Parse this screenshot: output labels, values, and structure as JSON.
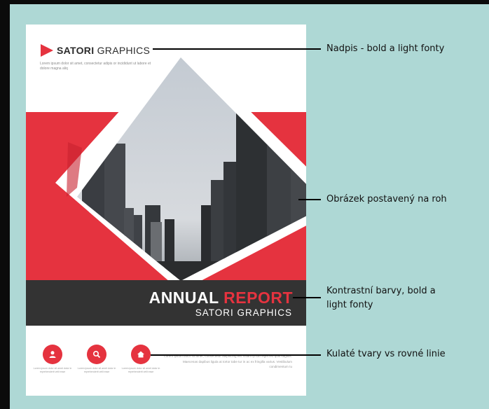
{
  "brochure": {
    "logo": {
      "bold": "SATORI",
      "light": "GRAPHICS"
    },
    "tagline": "Lorem ipsum dolor sit amet, consectetur adipis or incididunt ut labore et dolore magna aliq",
    "report_title": {
      "bold": "ANNUAL",
      "accent": "REPORT"
    },
    "report_subtitle": "SATORI GRAPHICS",
    "icons": [
      {
        "icon": "user-icon",
        "caption": "Lorem ipsum dolor sit amet dolor in reprehenderit velit esse"
      },
      {
        "icon": "search-icon",
        "caption": "Lorem ipsum dolor sit amet dolor in reprehenderit velit esse"
      },
      {
        "icon": "home-icon",
        "caption": "Lorem ipsum dolor sit amet dolor in reprehenderit velit esse"
      }
    ],
    "footer_text": "Lorem ipsum dolor sit amet, consectetur adipiscing elit. Etiam ip tum eget leo quis sagittis. Maecenas dapibus ligula at tortor tabe tur in ac ex fringilla varius. Vestibulum condimentum tu",
    "colors": {
      "accent": "#e5333f",
      "dark_band": "#333333",
      "background": "#aed8d5"
    }
  },
  "annotations": [
    {
      "text": "Nadpis - bold a light fonty"
    },
    {
      "text": "Obrázek postavený na roh"
    },
    {
      "text_line1": "Kontrastní barvy, bold a",
      "text_line2": "light fonty"
    },
    {
      "text": "Kulaté tvary vs rovné linie"
    }
  ]
}
